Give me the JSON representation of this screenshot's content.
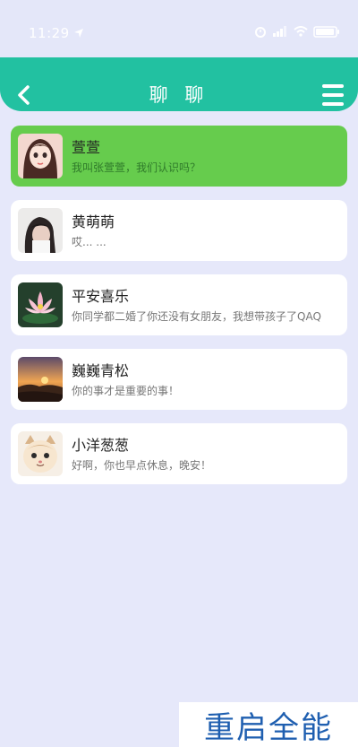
{
  "status_bar": {
    "time": "11:29"
  },
  "header": {
    "title": "聊 聊"
  },
  "chats": [
    {
      "name": "萱萱",
      "message": "我叫张萱萱，我们认识吗？",
      "active": true
    },
    {
      "name": "黄萌萌",
      "message": "哎...  ..."
    },
    {
      "name": "平安喜乐",
      "message": "你同学都二婚了你还没有女朋友，我想带孩子了QAQ"
    },
    {
      "name": "巍巍青松",
      "message": "你的事才是重要的事！"
    },
    {
      "name": "小洋葱葱",
      "message": "好啊，你也早点休息，晚安！"
    }
  ],
  "watermark": {
    "text": "重启全能"
  },
  "colors": {
    "header": "#22c1a1",
    "active_card": "#66cc4d",
    "background": "#e6e8fa"
  }
}
